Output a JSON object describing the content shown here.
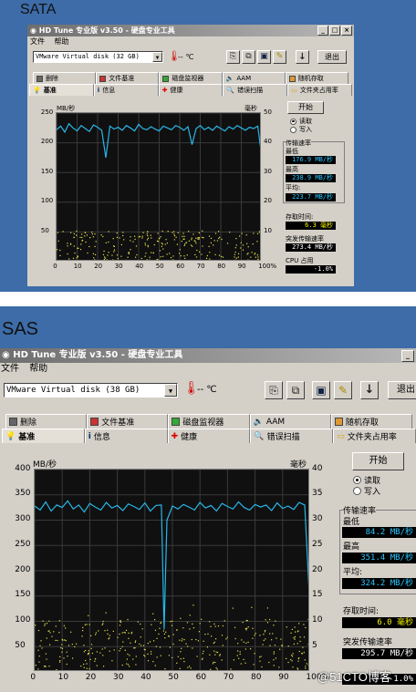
{
  "panels": [
    {
      "caption": "SATA",
      "window": {
        "title": "HD Tune 专业版 v3.50 - 硬盘专业工具",
        "menu": [
          "文件",
          "帮助"
        ],
        "disk": "VMware  Virtual disk (32 GB)",
        "temperature": "-- ℃",
        "exit_label": "退出",
        "tabs_row1": [
          "删除",
          "文件基准",
          "磁盘监视器",
          "AAM",
          "随机存取"
        ],
        "tabs_row2": [
          "基准",
          "信息",
          "健康",
          "错误扫描",
          "文件夹占用率"
        ],
        "active_tab": "基准",
        "start_label": "开始",
        "radio_read": "读取",
        "radio_write": "写入",
        "transfer_rate_label": "传输速率",
        "min_label": "最低",
        "min_value": "176.9 MB/秒",
        "max_label": "最高",
        "max_value": "238.9 MB/秒",
        "avg_label": "平均:",
        "avg_value": "223.7 MB/秒",
        "access_time_label": "存取时间:",
        "access_time_value": "6.3 毫秒",
        "burst_label": "突发传输速率",
        "burst_value": "273.4 MB/秒",
        "cpu_label": "CPU 占用",
        "cpu_value": "-1.0%",
        "unit_left": "MB/秒",
        "unit_right": "毫秒"
      },
      "chart_data": {
        "type": "line",
        "title": "",
        "xlabel": "",
        "ylabel": "MB/秒",
        "y2label": "毫秒",
        "xlim": [
          0,
          100
        ],
        "ylim": [
          0,
          250
        ],
        "y2lim": [
          0,
          50
        ],
        "x_ticks": [
          "0",
          "10",
          "20",
          "30",
          "40",
          "50",
          "60",
          "70",
          "80",
          "90",
          "100%"
        ],
        "y_ticks": [
          "250",
          "200",
          "150",
          "100",
          "50"
        ],
        "y2_ticks": [
          "50",
          "40",
          "30",
          "20",
          "10"
        ],
        "grid": true,
        "series": [
          {
            "name": "读取",
            "color": "#29b6e8",
            "x": [
              0,
              2,
              4,
              6,
              8,
              10,
              12,
              14,
              16,
              18,
              20,
              22,
              24,
              26,
              28,
              30,
              32,
              34,
              36,
              38,
              40,
              42,
              44,
              46,
              48,
              50,
              52,
              54,
              56,
              58,
              60,
              62,
              64,
              66,
              68,
              70,
              72,
              74,
              76,
              78,
              80,
              82,
              84,
              86,
              88,
              90,
              92,
              94,
              96,
              98,
              100
            ],
            "y": [
              222,
              228,
              218,
              232,
              225,
              220,
              229,
              224,
              219,
              230,
              226,
              221,
              175,
              228,
              223,
              226,
              221,
              229,
              225,
              220,
              231,
              224,
              222,
              227,
              223,
              220,
              228,
              225,
              222,
              229,
              226,
              221,
              227,
              197,
              224,
              229,
              222,
              226,
              221,
              228,
              224,
              220,
              227,
              223,
              229,
              225,
              221,
              226,
              224,
              228,
              176
            ]
          }
        ],
        "access_time_points": "scatter between 0 and 10 ms"
      }
    },
    {
      "caption": "SAS",
      "window": {
        "title": "HD Tune 专业版 v3.50 - 硬盘专业工具",
        "menu": [
          "文件",
          "帮助"
        ],
        "disk": "VMware  Virtual disk (38 GB)",
        "temperature": "-- ℃",
        "exit_label": "退出",
        "tabs_row1": [
          "删除",
          "文件基准",
          "磁盘监视器",
          "AAM",
          "随机存取"
        ],
        "tabs_row2": [
          "基准",
          "信息",
          "健康",
          "错误扫描",
          "文件夹占用率"
        ],
        "active_tab": "基准",
        "start_label": "开始",
        "radio_read": "读取",
        "radio_write": "写入",
        "transfer_rate_label": "传输速率",
        "min_label": "最低",
        "min_value": "84.2 MB/秒",
        "max_label": "最高",
        "max_value": "351.4 MB/秒",
        "avg_label": "平均:",
        "avg_value": "324.2 MB/秒",
        "access_time_label": "存取时间:",
        "access_time_value": "6.0 毫秒",
        "burst_label": "突发传输速率",
        "burst_value": "295.7 MB/秒",
        "cpu_value": "-1.0%",
        "unit_left": "MB/秒",
        "unit_right": "毫秒"
      },
      "chart_data": {
        "type": "line",
        "title": "",
        "xlabel": "",
        "ylabel": "MB/秒",
        "y2label": "毫秒",
        "xlim": [
          0,
          100
        ],
        "ylim": [
          0,
          400
        ],
        "y2lim": [
          0,
          40
        ],
        "x_ticks": [
          "0",
          "10",
          "20",
          "30",
          "40",
          "50",
          "60",
          "70",
          "80",
          "90",
          "100%"
        ],
        "y_ticks": [
          "400",
          "350",
          "300",
          "250",
          "200",
          "150",
          "100",
          "50"
        ],
        "y2_ticks": [
          "40",
          "35",
          "30",
          "25",
          "20",
          "15",
          "10",
          "5"
        ],
        "grid": true,
        "series": [
          {
            "name": "读取",
            "color": "#29b6e8",
            "x": [
              0,
              2,
              4,
              6,
              8,
              10,
              12,
              14,
              16,
              18,
              20,
              22,
              24,
              26,
              28,
              30,
              32,
              34,
              36,
              38,
              40,
              42,
              44,
              46,
              47,
              48,
              50,
              52,
              54,
              56,
              58,
              60,
              62,
              64,
              66,
              68,
              70,
              72,
              74,
              76,
              78,
              80,
              82,
              84,
              86,
              88,
              90,
              92,
              94,
              96,
              98,
              100
            ],
            "y": [
              328,
              320,
              336,
              318,
              330,
              325,
              338,
              322,
              330,
              316,
              333,
              326,
              320,
              335,
              324,
              329,
              319,
              332,
              327,
              321,
              334,
              318,
              329,
              330,
              84,
              300,
              328,
              322,
              331,
              326,
              320,
              335,
              324,
              329,
              318,
              333,
              327,
              322,
              336,
              325,
              320,
              331,
              326,
              330,
              319,
              334,
              323,
              328,
              321,
              335,
              330,
              120
            ]
          }
        ],
        "access_time_points": "scatter between 0 and 10 ms"
      }
    }
  ],
  "watermark": "@51CTO博客"
}
